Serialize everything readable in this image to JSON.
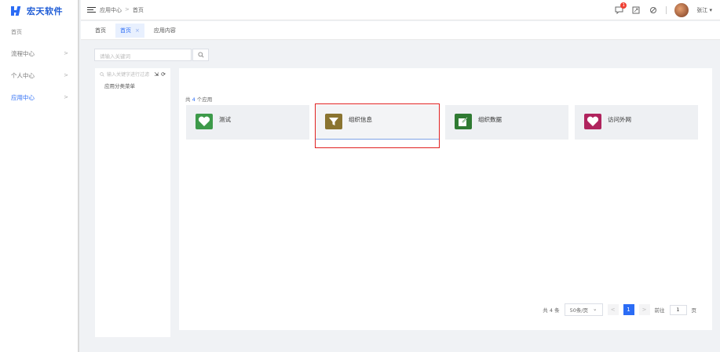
{
  "brand": {
    "name": "宏天软件"
  },
  "sidebar": {
    "items": [
      {
        "label": "首页"
      },
      {
        "label": "流程中心"
      },
      {
        "label": "个人中心"
      },
      {
        "label": "应用中心"
      }
    ],
    "accent": "#2b6cf5"
  },
  "header": {
    "breadcrumb": [
      "应用中心",
      ">",
      "首页"
    ],
    "notification_count": "1",
    "user_name": "张江"
  },
  "tabs": [
    {
      "label": "首页"
    },
    {
      "label": "首页"
    },
    {
      "label": "应用内容"
    }
  ],
  "search": {
    "placeholder": "请输入关键词"
  },
  "tree": {
    "search_placeholder": "输入关键字进行过滤",
    "nodes": [
      {
        "label": "应用分类菜单"
      }
    ]
  },
  "apps": {
    "count_prefix": "共",
    "count": "4",
    "count_suffix": "个应用",
    "items": [
      {
        "name": "测试",
        "icon": "heart-icon",
        "color": "#3d9a4a"
      },
      {
        "name": "组织信息",
        "icon": "funnel-icon",
        "color": "#8a7430"
      },
      {
        "name": "组织数据",
        "icon": "export-icon",
        "color": "#2f7a32"
      },
      {
        "name": "访问外网",
        "icon": "heart-icon",
        "color": "#b0245e"
      }
    ]
  },
  "pagination": {
    "total": "共 4 条",
    "page_size": "50条/页",
    "prev": "<",
    "current": "1",
    "next": ">",
    "goto_label": "前往",
    "goto_value": "1",
    "goto_suffix": "页"
  }
}
